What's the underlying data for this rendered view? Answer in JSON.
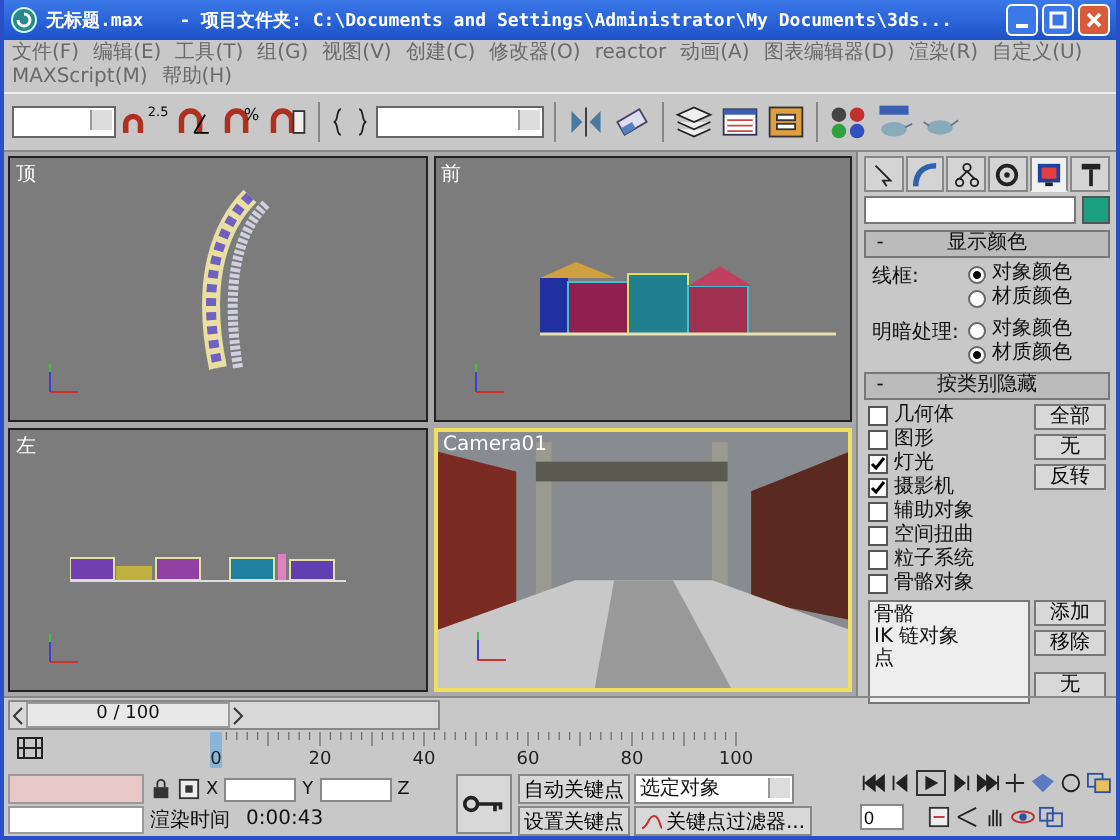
{
  "window": {
    "title": "无标题.max",
    "path": "- 项目文件夹: C:\\Documents and Settings\\Administrator\\My Documents\\3ds..."
  },
  "menu": [
    "文件(F)",
    "编辑(E)",
    "工具(T)",
    "组(G)",
    "视图(V)",
    "创建(C)",
    "修改器(O)",
    "reactor",
    "动画(A)",
    "图表编辑器(D)",
    "渲染(R)",
    "自定义(U)",
    "MAXScript(M)",
    "帮助(H)"
  ],
  "toolbar": {
    "snap_label": "2.5",
    "percent_label": "%"
  },
  "viewports": [
    {
      "label": "顶",
      "kind": "top",
      "active": false
    },
    {
      "label": "前",
      "kind": "front",
      "active": false
    },
    {
      "label": "左",
      "kind": "left",
      "active": false
    },
    {
      "label": "Camera01",
      "kind": "camera",
      "active": true
    }
  ],
  "command_panel": {
    "tabs": [
      {
        "kind": "create",
        "selected": false
      },
      {
        "kind": "modify",
        "selected": false
      },
      {
        "kind": "hierarchy",
        "selected": false
      },
      {
        "kind": "motion",
        "selected": false
      },
      {
        "kind": "display",
        "selected": true
      },
      {
        "kind": "utilities",
        "selected": false
      }
    ],
    "rollouts": [
      {
        "mark": "-",
        "title": "显示颜色",
        "groups": [
          {
            "label": "线框:",
            "options": [
              {
                "label": "对象颜色",
                "selected": true
              },
              {
                "label": "材质颜色",
                "selected": false
              }
            ]
          },
          {
            "label": "明暗处理:",
            "options": [
              {
                "label": "对象颜色",
                "selected": false
              },
              {
                "label": "材质颜色",
                "selected": true
              }
            ]
          }
        ]
      },
      {
        "mark": "-",
        "title": "按类别隐藏",
        "checkboxes": [
          {
            "label": "几何体",
            "checked": false
          },
          {
            "label": "图形",
            "checked": false
          },
          {
            "label": "灯光",
            "checked": true
          },
          {
            "label": "摄影机",
            "checked": true
          },
          {
            "label": "辅助对象",
            "checked": false
          },
          {
            "label": "空间扭曲",
            "checked": false
          },
          {
            "label": "粒子系统",
            "checked": false
          },
          {
            "label": "骨骼对象",
            "checked": false
          }
        ],
        "buttons": [
          "全部",
          "无",
          "反转"
        ],
        "list": [
          "骨骼",
          "IK 链对象",
          "点"
        ],
        "list_buttons": [
          "添加",
          "移除",
          "无"
        ]
      }
    ]
  },
  "time_slider": {
    "label": "0 / 100",
    "level": 0
  },
  "track_bar": {
    "ticks": [
      "0",
      "20",
      "40",
      "60",
      "80",
      "100"
    ]
  },
  "status": {
    "x_label": "X",
    "y_label": "Y",
    "z_label": "Z",
    "render_time_label": "渲染时间",
    "render_time": "0:00:43",
    "auto_key": "自动关键点",
    "set_key": "设置关键点",
    "selection": "选定对象",
    "key_filters": "关键点过滤器...",
    "frame": "0"
  }
}
